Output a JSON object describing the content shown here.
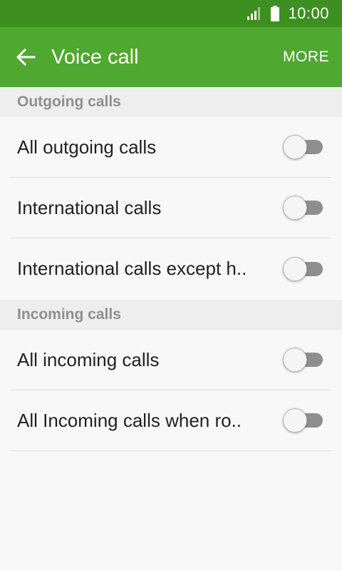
{
  "status_bar": {
    "time": "10:00"
  },
  "app_bar": {
    "title": "Voice call",
    "more_label": "MORE"
  },
  "sections": [
    {
      "header": "Outgoing calls",
      "items": [
        {
          "label": "All outgoing calls",
          "enabled": false
        },
        {
          "label": "International calls",
          "enabled": false
        },
        {
          "label": "International calls except h..",
          "enabled": false
        }
      ]
    },
    {
      "header": "Incoming calls",
      "items": [
        {
          "label": "All incoming calls",
          "enabled": false
        },
        {
          "label": "All Incoming calls when ro..",
          "enabled": false
        }
      ]
    }
  ],
  "colors": {
    "status_bar": "#3d8f1f",
    "app_bar": "#4fa830",
    "section_bg": "#eeeeee"
  }
}
